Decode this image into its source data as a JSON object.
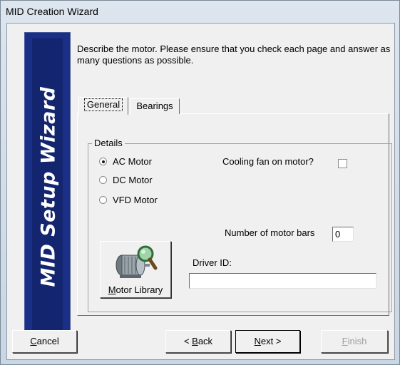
{
  "window": {
    "title": "MID Creation Wizard"
  },
  "banner": {
    "text": "MID Setup Wizard"
  },
  "description": "Describe the motor.  Please ensure that you check each page and answer as many questions as possible.",
  "tabs": [
    {
      "label": "General",
      "active": true
    },
    {
      "label": "Bearings",
      "active": false
    }
  ],
  "details": {
    "group_title": "Details",
    "motor_types": [
      {
        "label": "AC Motor",
        "selected": true
      },
      {
        "label": "DC Motor",
        "selected": false
      },
      {
        "label": "VFD Motor",
        "selected": false
      }
    ],
    "cooling_fan_label": "Cooling fan on motor?",
    "cooling_fan_checked": false,
    "motor_bars_label": "Number of motor bars",
    "motor_bars_value": "0",
    "driver_id_label": "Driver ID:",
    "driver_id_value": ""
  },
  "motor_library": {
    "label_underlined": "M",
    "label_rest": "otor Library",
    "icon": "motor-with-magnifier-icon"
  },
  "buttons": {
    "cancel": {
      "u": "C",
      "rest": "ancel"
    },
    "back": {
      "pre": "< ",
      "u": "B",
      "rest": "ack"
    },
    "next": {
      "u": "N",
      "rest": "ext >"
    },
    "finish": {
      "u": "F",
      "rest": "inish"
    }
  },
  "colors": {
    "banner": "#1a2f86",
    "text": "#000000",
    "disabled": "#a0a0a0"
  }
}
